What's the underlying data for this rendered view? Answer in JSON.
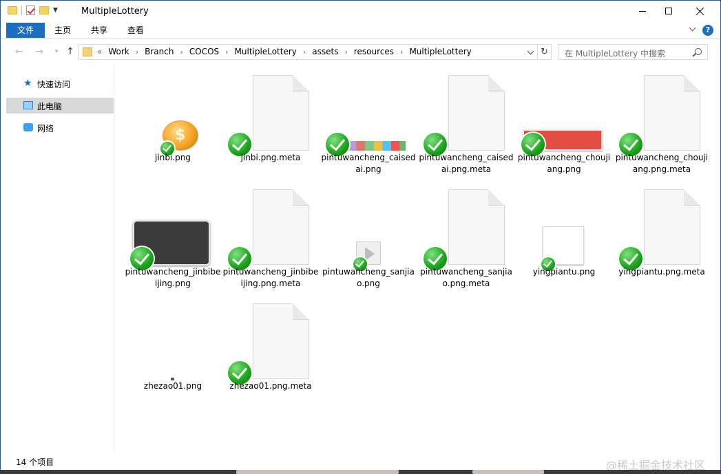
{
  "window": {
    "title": "MultipleLottery"
  },
  "ribbon": {
    "tabs": [
      "文件",
      "主页",
      "共享",
      "查看"
    ],
    "help_label": "?"
  },
  "address": {
    "lead": "«",
    "crumbs": [
      "Work",
      "Branch",
      "COCOS",
      "MultipleLottery",
      "assets",
      "resources",
      "MultipleLottery"
    ],
    "search_placeholder": "在 MultipleLottery 中搜索"
  },
  "sidebar": {
    "items": [
      {
        "label": "快速访问",
        "icon": "quick-access-star-icon",
        "selected": false
      },
      {
        "label": "此电脑",
        "icon": "this-pc-icon",
        "selected": true
      },
      {
        "label": "网络",
        "icon": "network-icon",
        "selected": false
      }
    ]
  },
  "files": [
    {
      "name": "jinbi.png",
      "kind": "coin-image",
      "synced": true
    },
    {
      "name": "jinbi.png.meta",
      "kind": "document",
      "synced": true
    },
    {
      "name": "pintuwancheng_caisedai.png",
      "kind": "color-strip-image",
      "synced": true
    },
    {
      "name": "pintuwancheng_caisedai.png.meta",
      "kind": "document",
      "synced": true
    },
    {
      "name": "pintuwancheng_choujiang.png",
      "kind": "red-bar-image",
      "synced": true
    },
    {
      "name": "pintuwancheng_choujiang.png.meta",
      "kind": "document",
      "synced": true
    },
    {
      "name": "pintuwancheng_jinbibeijing.png",
      "kind": "dark-panel-image",
      "synced": true
    },
    {
      "name": "pintuwancheng_jinbibeijing.png.meta",
      "kind": "document",
      "synced": true
    },
    {
      "name": "pintuwancheng_sanjiao.png",
      "kind": "triangle-image",
      "synced": true
    },
    {
      "name": "pintuwancheng_sanjiao.png.meta",
      "kind": "document",
      "synced": true
    },
    {
      "name": "yingpiantu.png",
      "kind": "white-image",
      "synced": true
    },
    {
      "name": "yingpiantu.png.meta",
      "kind": "document",
      "synced": true
    },
    {
      "name": "zhezao01.png",
      "kind": "tiny-image",
      "synced": false
    },
    {
      "name": "zhezao01.png.meta",
      "kind": "document",
      "synced": true
    }
  ],
  "status": {
    "count": "14 个项目"
  },
  "watermark": "@稀土掘金技术社区",
  "colors": {
    "accent": "#1a6fc0",
    "sync_ok": "#19a319",
    "selection": "#d9d9d9"
  }
}
